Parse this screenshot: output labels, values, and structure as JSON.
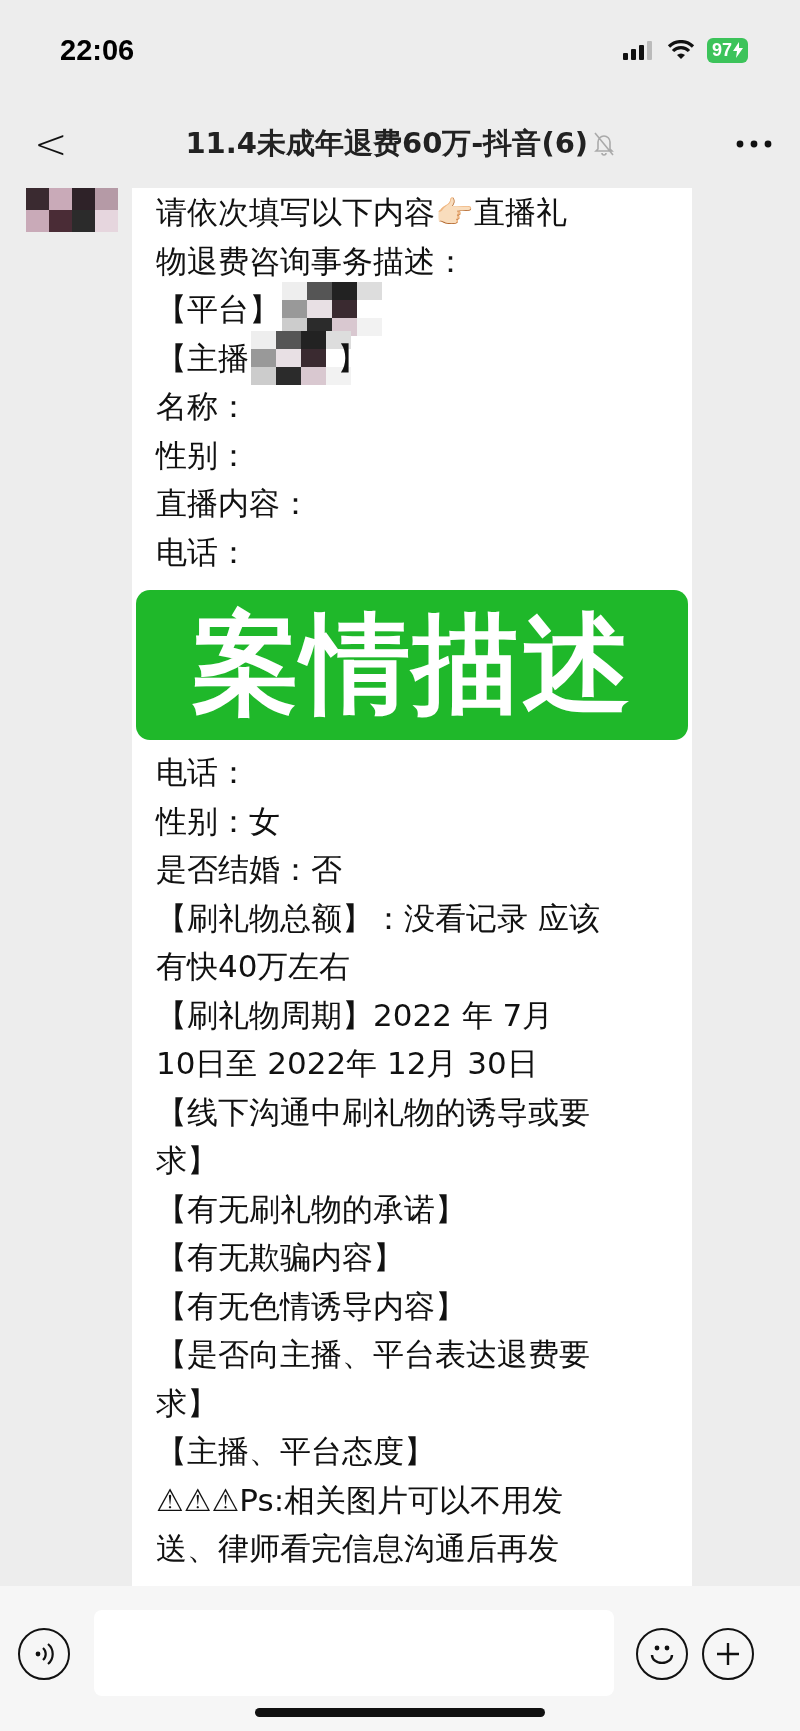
{
  "status_bar": {
    "time": "22:06",
    "battery": "97"
  },
  "nav": {
    "back": "<",
    "title": "11.4未成年退费60万-抖音(6)",
    "muted": true
  },
  "message": {
    "lines_top": [
      {
        "kind": "text",
        "text": "请依次填写以下内容👉🏻直播礼"
      },
      {
        "kind": "text",
        "text": "物退费咨询事务描述："
      },
      {
        "kind": "redacted",
        "before": "【平台】"
      },
      {
        "kind": "redacted",
        "before": "【主播",
        "after": "】"
      },
      {
        "kind": "text",
        "text": "名称："
      },
      {
        "kind": "text",
        "text": "性别："
      },
      {
        "kind": "text",
        "text": "直播内容："
      },
      {
        "kind": "text",
        "text": "电话："
      }
    ],
    "lines_bottom": [
      {
        "kind": "text",
        "text": "电话："
      },
      {
        "kind": "text",
        "text": "性别：女"
      },
      {
        "kind": "text",
        "text": "是否结婚：否"
      },
      {
        "kind": "text",
        "text": "【刷礼物总额】：没看记录 应该"
      },
      {
        "kind": "text",
        "text": "有快40万左右"
      },
      {
        "kind": "text",
        "text": "【刷礼物周期】2022 年  7月"
      },
      {
        "kind": "text",
        "text": "10日至 2022年 12月  30日"
      },
      {
        "kind": "text",
        "text": "【线下沟通中刷礼物的诱导或要"
      },
      {
        "kind": "text",
        "text": "求】"
      },
      {
        "kind": "text",
        "text": "【有无刷礼物的承诺】"
      },
      {
        "kind": "text",
        "text": "【有无欺骗内容】"
      },
      {
        "kind": "text",
        "text": "【有无色情诱导内容】"
      },
      {
        "kind": "text",
        "text": "【是否向主播、平台表达退费要"
      },
      {
        "kind": "text",
        "text": "求】"
      },
      {
        "kind": "text",
        "text": "【主播、平台态度】"
      },
      {
        "kind": "text",
        "text": "⚠⚠⚠Ps:相关图片可以不用发"
      },
      {
        "kind": "text",
        "text": "送、律师看完信息沟通后再发"
      }
    ]
  },
  "banner": {
    "text": "案情描述"
  }
}
